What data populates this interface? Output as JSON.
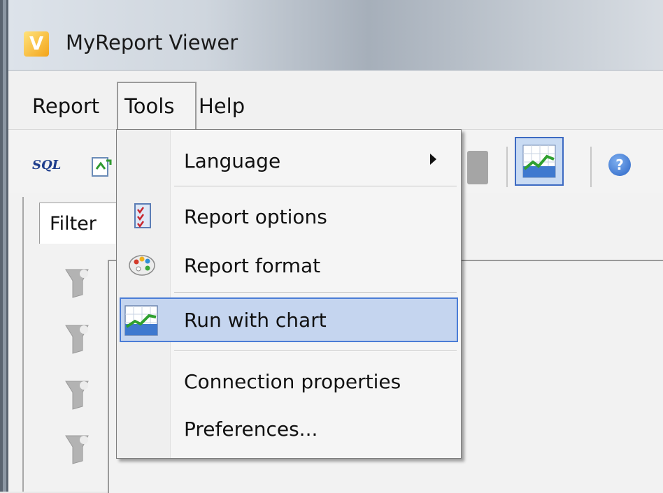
{
  "window": {
    "title": "MyReport Viewer",
    "logo_letter": "V"
  },
  "menubar": {
    "items": [
      "Report",
      "Tools",
      "Help"
    ],
    "open_menu": "Tools"
  },
  "toolbar": {
    "sql_label": "SQL",
    "help_glyph": "?"
  },
  "panel": {
    "filter_tab": "Filter"
  },
  "tools_menu": {
    "items": [
      {
        "label": "Language",
        "icon": "none",
        "submenu": true
      },
      {
        "label": "Report options",
        "icon": "checklist-icon"
      },
      {
        "label": "Report format",
        "icon": "palette-icon"
      },
      {
        "label": "Run with chart",
        "icon": "chart-icon",
        "highlighted": true
      },
      {
        "label": "Connection properties",
        "icon": "none"
      },
      {
        "label": "Preferences...",
        "icon": "none"
      }
    ]
  },
  "colors": {
    "highlight_fill": "#c5d5ef",
    "highlight_border": "#4a7cd6",
    "sql_blue": "#1e3d8c"
  }
}
